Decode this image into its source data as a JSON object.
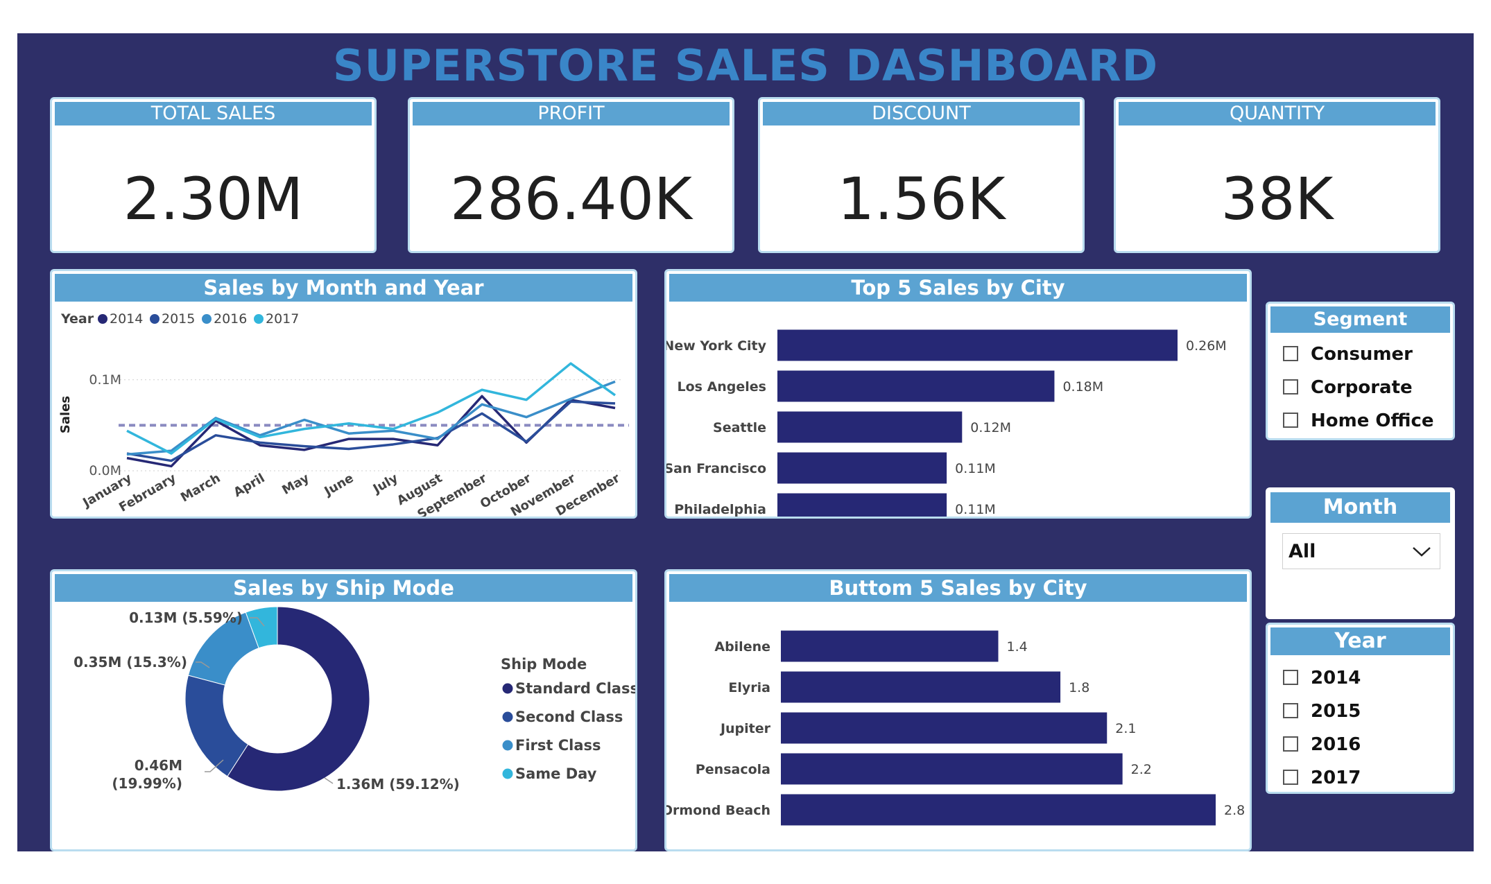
{
  "title": "SUPERSTORE SALES DASHBOARD",
  "kpis": [
    {
      "label": "TOTAL SALES",
      "value": "2.30M"
    },
    {
      "label": "PROFIT",
      "value": "286.40K"
    },
    {
      "label": "DISCOUNT",
      "value": "1.56K"
    },
    {
      "label": "QUANTITY",
      "value": "38K"
    }
  ],
  "colors": {
    "background": "#2e2f68",
    "header": "#5ba3d2",
    "title": "#3a86c8",
    "bar": "#262875",
    "y2014": "#262875",
    "y2015": "#2a4d9a",
    "y2016": "#3a8ec9",
    "y2017": "#32b6dc"
  },
  "line_chart": {
    "title": "Sales by Month and Year",
    "legend_title": "Year",
    "ylabel": "Sales",
    "y_ticks": [
      "0.1M",
      "0.0M"
    ]
  },
  "top5": {
    "title": "Top 5 Sales by City"
  },
  "bottom5": {
    "title": "Buttom 5 Sales by City"
  },
  "ship": {
    "title": "Sales by Ship Mode",
    "legend_title": "Ship Mode"
  },
  "segment": {
    "title": "Segment",
    "items": [
      "Consumer",
      "Corporate",
      "Home Office"
    ]
  },
  "month": {
    "title": "Month",
    "selected": "All"
  },
  "year": {
    "title": "Year",
    "items": [
      "2014",
      "2015",
      "2016",
      "2017"
    ]
  },
  "chart_data": [
    {
      "type": "line",
      "title": "Sales by Month and Year",
      "xlabel": "",
      "ylabel": "Sales",
      "ylim": [
        0,
        0.125
      ],
      "categories": [
        "January",
        "February",
        "March",
        "April",
        "May",
        "June",
        "July",
        "August",
        "September",
        "October",
        "November",
        "December"
      ],
      "reference_line": 0.05,
      "series": [
        {
          "name": "2014",
          "values": [
            0.014,
            0.005,
            0.055,
            0.028,
            0.023,
            0.035,
            0.035,
            0.028,
            0.082,
            0.031,
            0.078,
            0.069
          ]
        },
        {
          "name": "2015",
          "values": [
            0.019,
            0.011,
            0.039,
            0.031,
            0.027,
            0.024,
            0.029,
            0.036,
            0.063,
            0.032,
            0.076,
            0.074
          ]
        },
        {
          "name": "2016",
          "values": [
            0.018,
            0.022,
            0.058,
            0.039,
            0.056,
            0.041,
            0.044,
            0.035,
            0.073,
            0.059,
            0.079,
            0.098
          ]
        },
        {
          "name": "2017",
          "values": [
            0.044,
            0.019,
            0.057,
            0.037,
            0.046,
            0.052,
            0.046,
            0.064,
            0.089,
            0.078,
            0.118,
            0.083
          ]
        }
      ]
    },
    {
      "type": "bar",
      "title": "Top 5 Sales by City",
      "categories": [
        "New York City",
        "Los Angeles",
        "Seattle",
        "San Francisco",
        "Philadelphia"
      ],
      "values": [
        0.26,
        0.18,
        0.12,
        0.11,
        0.11
      ],
      "labels": [
        "0.26M",
        "0.18M",
        "0.12M",
        "0.11M",
        "0.11M"
      ],
      "xlim": [
        0,
        0.26
      ]
    },
    {
      "type": "pie",
      "title": "Sales by Ship Mode",
      "categories": [
        "Standard Class",
        "Second Class",
        "First Class",
        "Same Day"
      ],
      "values": [
        59.12,
        19.99,
        15.3,
        5.59
      ],
      "labels": [
        "1.36M (59.12%)",
        "0.46M (19.99%)",
        "0.35M (15.3%)",
        "0.13M (5.59%)"
      ]
    },
    {
      "type": "bar",
      "title": "Buttom 5 Sales by City",
      "categories": [
        "Abilene",
        "Elyria",
        "Jupiter",
        "Pensacola",
        "Ormond Beach"
      ],
      "values": [
        1.4,
        1.8,
        2.1,
        2.2,
        2.8
      ],
      "labels": [
        "1.4",
        "1.8",
        "2.1",
        "2.2",
        "2.8"
      ],
      "xlim": [
        0,
        2.8
      ]
    }
  ]
}
